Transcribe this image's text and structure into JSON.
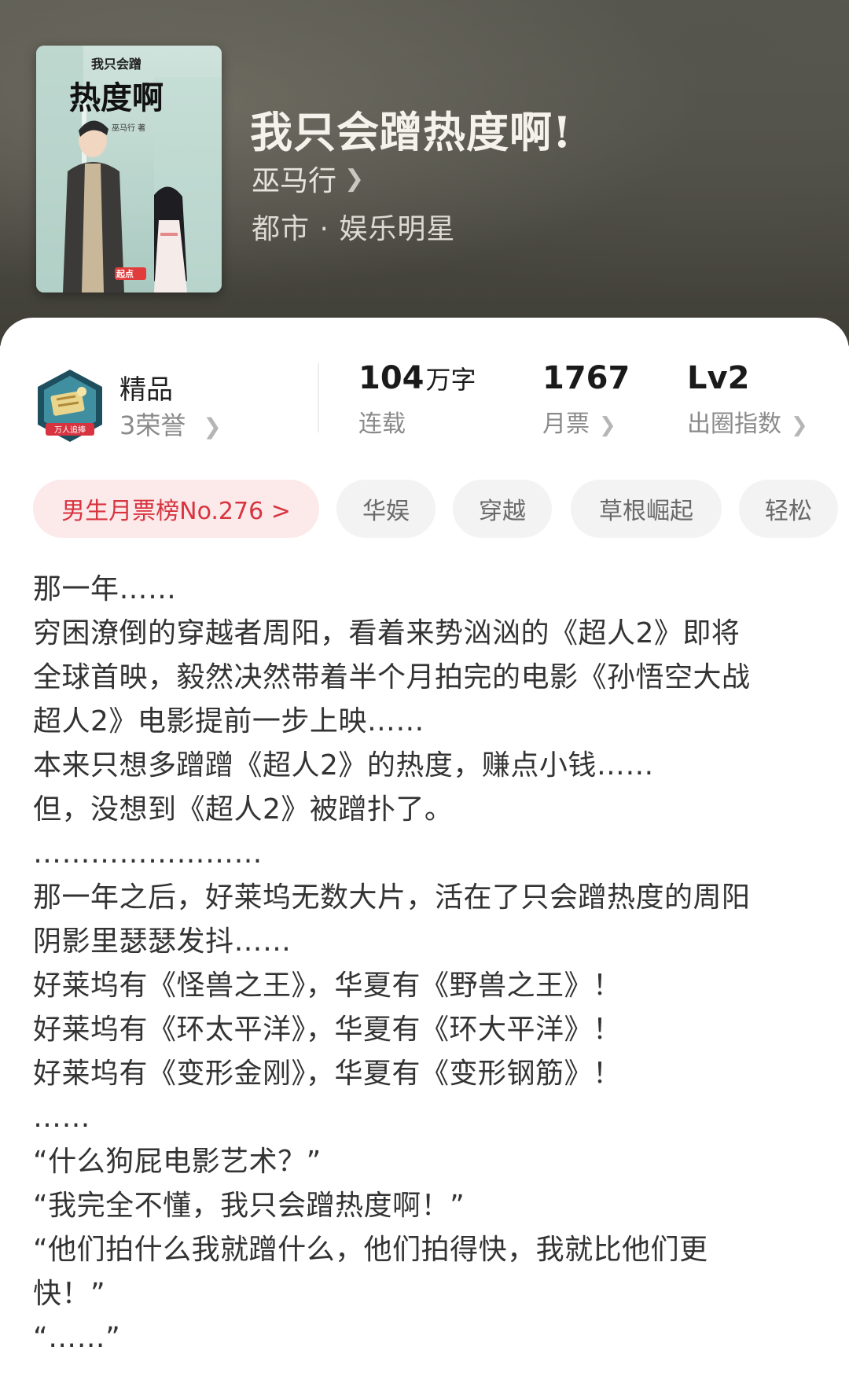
{
  "book": {
    "title": "我只会蹭热度啊!",
    "author": "巫马行",
    "genre": "都市 · 娱乐明星",
    "cover": {
      "small_title": "我只会蹭",
      "big_title": "热度啊",
      "author_text": "巫马行 著",
      "publisher_mark": "起点"
    }
  },
  "honor": {
    "badge_text": "万人追捧",
    "title": "精品",
    "subtitle": "3荣誉"
  },
  "stats": {
    "words_value": "104",
    "words_unit": "万字",
    "words_label": "连载",
    "ticket_value": "1767",
    "ticket_label": "月票",
    "level_value": "Lv2",
    "level_label": "出圈指数"
  },
  "tags": {
    "rank": "男生月票榜No.276 >",
    "items": [
      "华娱",
      "穿越",
      "草根崛起",
      "轻松"
    ]
  },
  "synopsis": {
    "lines": [
      "那一年……",
      "穷困潦倒的穿越者周阳，看着来势汹汹的《超人2》即将",
      "全球首映，毅然决然带着半个月拍完的电影《孙悟空大战",
      "超人2》电影提前一步上映……",
      "本来只想多蹭蹭《超人2》的热度，赚点小钱……",
      "但，没想到《超人2》被蹭扑了。",
      "……………………",
      "那一年之后，好莱坞无数大片，活在了只会蹭热度的周阳",
      "阴影里瑟瑟发抖……",
      "好莱坞有《怪兽之王》，华夏有《野兽之王》！",
      "好莱坞有《环太平洋》，华夏有《环大平洋》！",
      "好莱坞有《变形金刚》，华夏有《变形钢筋》！",
      "……",
      "“什么狗屁电影艺术？”",
      "“我完全不懂，我只会蹭热度啊！”",
      "“他们拍什么我就蹭什么，他们拍得快，我就比他们更",
      "快！”",
      "“……”"
    ]
  },
  "colors": {
    "header_bg": "#4c4b43",
    "rank_tag_bg": "#fce9ea",
    "rank_tag_text": "#d8343f",
    "tag_bg": "#f3f3f3",
    "body_text": "#333333",
    "muted_text": "#8a8a8a"
  },
  "icons": {
    "author_link": "chevron-right-icon",
    "honor_badge": "honor-badge-icon"
  }
}
